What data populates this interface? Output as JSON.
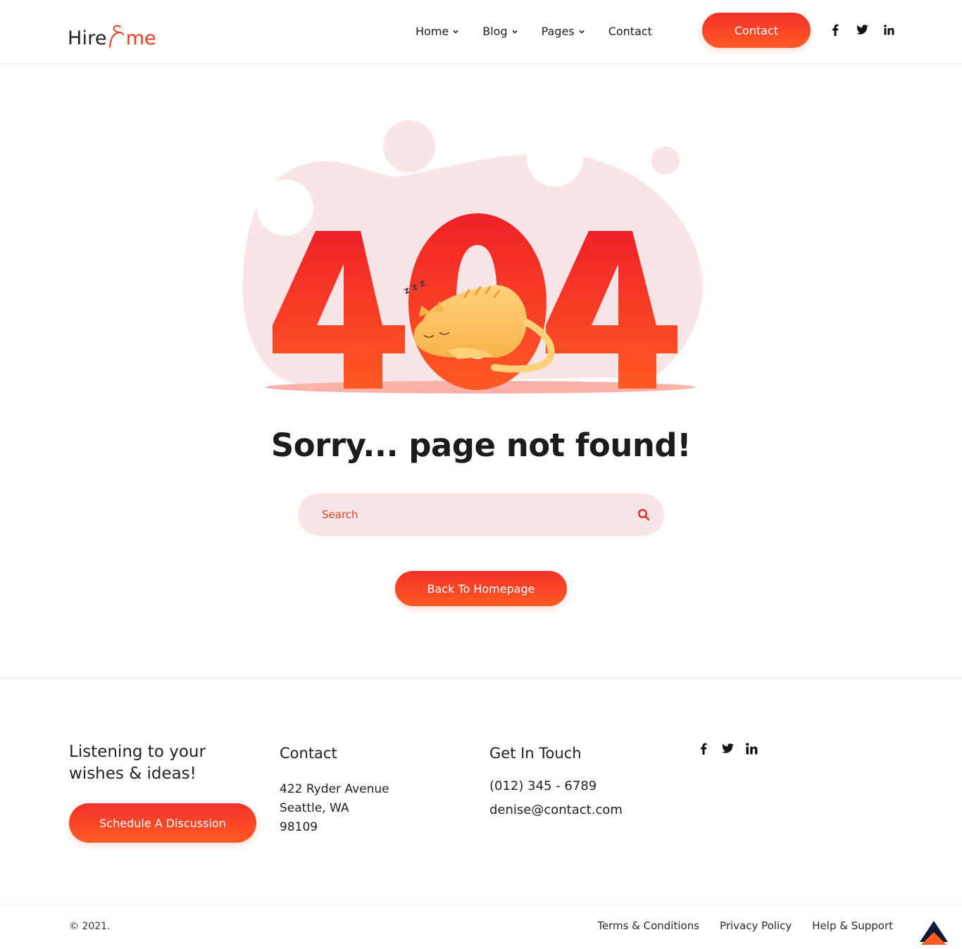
{
  "brand": {
    "logo_first": "Hire",
    "logo_second": "me",
    "accent": "#ef3b24",
    "accent_end": "#ff5a24",
    "soft_pink": "#fae5e6"
  },
  "nav": {
    "items": [
      {
        "label": "Home",
        "has_dropdown": true
      },
      {
        "label": "Blog",
        "has_dropdown": true
      },
      {
        "label": "Pages",
        "has_dropdown": true
      },
      {
        "label": "Contact",
        "has_dropdown": false
      }
    ],
    "cta_label": "Contact",
    "social": [
      "facebook-icon",
      "twitter-icon",
      "linkedin-icon"
    ]
  },
  "hero": {
    "illustration": {
      "code": "404",
      "snore": "z z z"
    },
    "headline": "Sorry... page not found!",
    "search": {
      "placeholder": "Search",
      "value": ""
    },
    "back_label": "Back To Homepage"
  },
  "footer": {
    "tagline": "Listening to your wishes & ideas!",
    "schedule_label": "Schedule A Discussion",
    "contact": {
      "title": "Contact",
      "address_lines": [
        "422 Ryder Avenue",
        "Seattle, WA",
        "98109"
      ]
    },
    "touch": {
      "title": "Get In Touch",
      "phone": "(012) 345 - 6789",
      "email": "denise@contact.com"
    },
    "social": [
      "facebook-icon",
      "twitter-icon",
      "linkedin-icon"
    ],
    "copyright": "© 2021.",
    "links": [
      "Terms & Conditions",
      "Privacy Policy",
      "Help & Support"
    ]
  }
}
